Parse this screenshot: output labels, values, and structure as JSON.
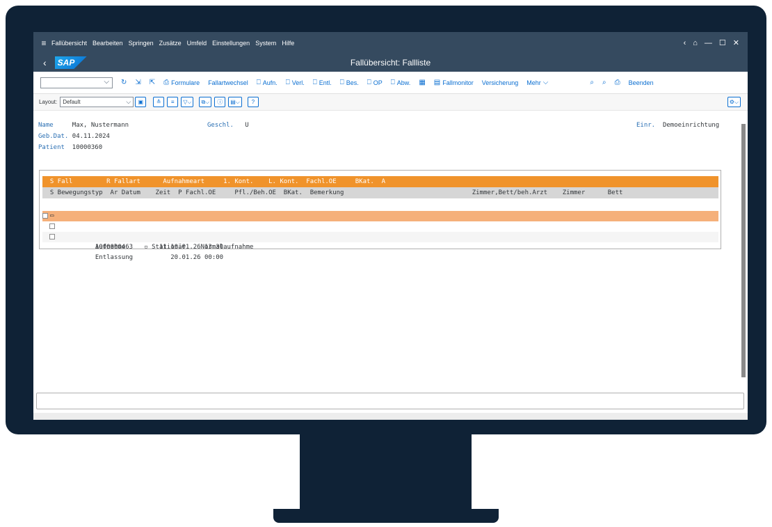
{
  "menubar": {
    "items": [
      "Fallübersicht",
      "Bearbeiten",
      "Springen",
      "Zusätze",
      "Umfeld",
      "Einstellungen",
      "System",
      "Hilfe"
    ]
  },
  "titlebar": {
    "logo": "SAP",
    "title": "Fallübersicht: Fallliste"
  },
  "toolbar": {
    "formulare": "Formulare",
    "fallartwechsel": "Fallartwechsel",
    "aufn": "Aufn.",
    "verl": "Verl.",
    "entl": "Entl.",
    "bes": "Bes.",
    "op": "OP",
    "abw": "Abw.",
    "fallmonitor": "Fallmonitor",
    "versicherung": "Versicherung",
    "mehr": "Mehr",
    "beenden": "Beenden"
  },
  "layoutbar": {
    "label": "Layout:",
    "value": "Default"
  },
  "patient": {
    "name_label": "Name",
    "name_value": "Max, Nustermann",
    "geschl_label": "Geschl.",
    "geschl_value": "U",
    "einr_label": "Einr.",
    "einr_value": "Demoeinrichtung",
    "gebdat_label": "Geb.Dat.",
    "gebdat_value": "04.11.2024",
    "patient_label": "Patient",
    "patient_value": "10000360"
  },
  "table": {
    "header1": "  S Fall         R Fallart      Aufnahmeart     1. Kont.    L. Kont.  Fachl.OE     BKat.  A",
    "header2": "  S Bewegungstyp  Ar Datum    Zeit  P Fachl.OE     Pfl./Beh.OE  BKat.  Bemerkung                                  Zimmer,Bett/beh.Arzt    Zimmer      Bett",
    "case_row": "    1000000463   ▫ Stationär    Normalaufnahme",
    "rows": [
      "    Aufnahme         11 10.01.26 13:30",
      "    Entlassung          20.01.26 00:00"
    ]
  }
}
